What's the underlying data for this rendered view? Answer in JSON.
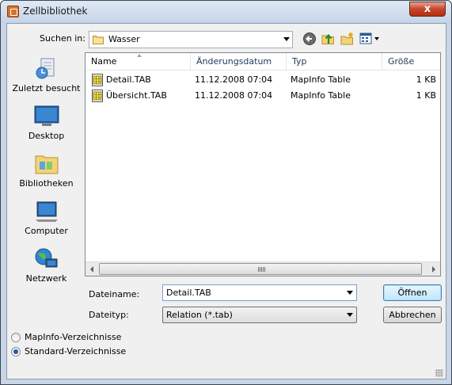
{
  "window": {
    "title": "Zellbibliothek",
    "close_label": "x"
  },
  "lookin": {
    "label": "Suchen in:",
    "value": "Wasser"
  },
  "toolbar": {
    "icons": [
      "back-icon",
      "up-folder-icon",
      "new-folder-icon",
      "view-menu-icon"
    ]
  },
  "places": [
    {
      "label": "Zuletzt besucht",
      "icon": "recent-places-icon"
    },
    {
      "label": "Desktop",
      "icon": "desktop-icon"
    },
    {
      "label": "Bibliotheken",
      "icon": "libraries-icon"
    },
    {
      "label": "Computer",
      "icon": "computer-icon"
    },
    {
      "label": "Netzwerk",
      "icon": "network-icon"
    }
  ],
  "columns": {
    "name": "Name",
    "date": "Änderungsdatum",
    "type": "Typ",
    "size": "Größe"
  },
  "files": [
    {
      "name": "Detail.TAB",
      "date": "11.12.2008 07:04",
      "type": "MapInfo Table",
      "size": "1 KB"
    },
    {
      "name": "Übersicht.TAB",
      "date": "11.12.2008 07:04",
      "type": "MapInfo Table",
      "size": "1 KB"
    }
  ],
  "filename": {
    "label": "Dateiname:",
    "value": "Detail.TAB"
  },
  "filetype": {
    "label": "Dateityp:",
    "value": "Relation (*.tab)"
  },
  "buttons": {
    "open": "Öffnen",
    "cancel": "Abbrechen"
  },
  "radios": [
    {
      "label": "MapInfo-Verzeichnisse",
      "checked": false
    },
    {
      "label": "Standard-Verzeichnisse",
      "checked": true
    }
  ]
}
